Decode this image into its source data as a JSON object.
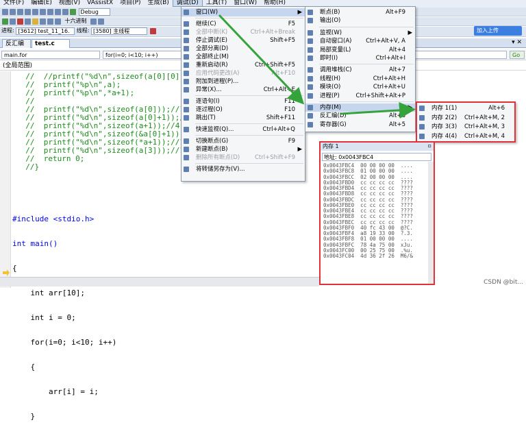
{
  "menubar": [
    "文件(F)",
    "编辑(E)",
    "视图(V)",
    "VAssistX",
    "项目(P)",
    "生成(B)",
    "调试(D)",
    "工具(T)",
    "窗口(W)",
    "帮助(H)"
  ],
  "toolbar": {
    "config": "Debug",
    "hex": "十六进制"
  },
  "process_bar": {
    "process_label": "进程:",
    "process_value": "[3612] test_11_16.",
    "thread_label": "线程:",
    "thread_value": "[3580] 主线程"
  },
  "reload_button": "加入上传",
  "tabs": [
    "反汇编",
    "test.c"
  ],
  "nav": {
    "left": "main.for",
    "right": "for(i=0; i<10; i++)",
    "go": "Go"
  },
  "scope": "(全局范围)",
  "code_lines": [
    {
      "t": "cm",
      "s": "  //  //printf(\"%d\\n\",sizeof(a[0][0]))"
    },
    {
      "t": "cm",
      "s": "  //  printf(\"%p\\n\",a);"
    },
    {
      "t": "cm",
      "s": "  //  printf(\"%p\\n\",*a+1);"
    },
    {
      "t": "cm",
      "s": "  //"
    },
    {
      "t": "cm",
      "s": "  //  printf(\"%d\\n\",sizeof(a[0]));//16"
    },
    {
      "t": "cm",
      "s": "  //  printf(\"%d\\n\",sizeof(a[0]+1));//4"
    },
    {
      "t": "cm",
      "s": "  //  printf(\"%d\\n\",sizeof(a+1));//4"
    },
    {
      "t": "cm",
      "s": "  //  printf(\"%d\\n\",sizeof(&a[0]+1));/"
    },
    {
      "t": "cm",
      "s": "  //  printf(\"%d\\n\",sizeof(*a+1));//16"
    },
    {
      "t": "cm",
      "s": "  //  printf(\"%d\\n\",sizeof(a[3]));//16"
    },
    {
      "t": "cm",
      "s": "  //  return 0;"
    },
    {
      "t": "cm",
      "s": "  //}"
    }
  ],
  "code2": {
    "include": "#include <stdio.h>",
    "main": "int main()",
    "brace": "{",
    "arr": "    int arr[10];",
    "i": "    int i = 0;",
    "for": "    for(i=0; i<10; i++)",
    "brace2": "    {",
    "assign": "        arr[i] = i;",
    "brace3": "    }"
  },
  "debug_menu": [
    {
      "label": "窗口(W)",
      "arrow": "▶",
      "hl": true
    },
    {
      "sep": true
    },
    {
      "label": "继续(C)",
      "shortcut": "F5"
    },
    {
      "label": "全部中断(K)",
      "shortcut": "Ctrl+Alt+Break",
      "dis": true
    },
    {
      "label": "停止调试(E)",
      "shortcut": "Shift+F5"
    },
    {
      "label": "全部分离(D)"
    },
    {
      "label": "全部终止(M)"
    },
    {
      "label": "重新启动(R)",
      "shortcut": "Ctrl+Shift+F5"
    },
    {
      "label": "应用代码更改(A)",
      "shortcut": "Alt+F10",
      "dis": true
    },
    {
      "label": "附加到进程(P)..."
    },
    {
      "label": "异常(X)...",
      "shortcut": "Ctrl+Alt+E"
    },
    {
      "sep": true
    },
    {
      "label": "逐语句(I)",
      "shortcut": "F11"
    },
    {
      "label": "逐过程(O)",
      "shortcut": "F10"
    },
    {
      "label": "跳出(T)",
      "shortcut": "Shift+F11"
    },
    {
      "sep": true
    },
    {
      "label": "快速监视(Q)...",
      "shortcut": "Ctrl+Alt+Q"
    },
    {
      "sep": true
    },
    {
      "label": "切换断点(G)",
      "shortcut": "F9"
    },
    {
      "label": "新建断点(B)",
      "arrow": "▶"
    },
    {
      "label": "删除所有断点(D)",
      "shortcut": "Ctrl+Shift+F9",
      "dis": true
    },
    {
      "sep": true
    },
    {
      "label": "将转储另存为(V)..."
    }
  ],
  "window_menu": [
    {
      "label": "断点(B)",
      "shortcut": "Alt+F9"
    },
    {
      "label": "输出(O)"
    },
    {
      "sep": true
    },
    {
      "label": "监视(W)",
      "arrow": "▶"
    },
    {
      "label": "自动窗口(A)",
      "shortcut": "Ctrl+Alt+V, A"
    },
    {
      "label": "局部变量(L)",
      "shortcut": "Alt+4"
    },
    {
      "label": "即时(I)",
      "shortcut": "Ctrl+Alt+I"
    },
    {
      "sep": true
    },
    {
      "label": "调用堆栈(C)",
      "shortcut": "Alt+7"
    },
    {
      "label": "线程(H)",
      "shortcut": "Ctrl+Alt+H"
    },
    {
      "label": "模块(O)",
      "shortcut": "Ctrl+Alt+U"
    },
    {
      "label": "进程(P)",
      "shortcut": "Ctrl+Shift+Alt+P"
    },
    {
      "sep": true
    },
    {
      "label": "内存(M)",
      "arrow": "▶",
      "hl": true
    },
    {
      "label": "反汇编(D)",
      "shortcut": "Alt+8"
    },
    {
      "label": "寄存器(G)",
      "shortcut": "Alt+5"
    }
  ],
  "memory_submenu": [
    {
      "label": "内存 1(1)",
      "shortcut": "Alt+6"
    },
    {
      "label": "内存 2(2)",
      "shortcut": "Ctrl+Alt+M, 2"
    },
    {
      "label": "内存 3(3)",
      "shortcut": "Ctrl+Alt+M, 3"
    },
    {
      "label": "内存 4(4)",
      "shortcut": "Ctrl+Alt+M, 4"
    }
  ],
  "memory_window": {
    "title": "内存 1",
    "address": "地址: 0x0043FBC4",
    "rows": [
      "0x0043FBC4  00 00 00 00  ....",
      "0x0043FBC8  01 00 00 00  ....",
      "0x0043FBCC  02 00 00 00  ....",
      "0x0043FBD0  cc cc cc cc  ????",
      "0x0043FBD4  cc cc cc cc  ????",
      "0x0043FBD8  cc cc cc cc  ????",
      "0x0043FBDC  cc cc cc cc  ????",
      "0x0043FBE0  cc cc cc cc  ????",
      "0x0043FBE4  cc cc cc cc  ????",
      "0x0043FBE8  cc cc cc cc  ????",
      "0x0043FBEC  cc cc cc cc  ????",
      "0x0043FBF0  40 fc 43 00  @?C.",
      "0x0043FBF4  a8 19 33 00  ?.3.",
      "0x0043FBF8  01 00 00 00  ....",
      "0x0043FBFC  78 4a 75 00  xJu.",
      "0x0043FC00  00 25 75 00  .%u.",
      "0x0043FC04  4d 36 2f 26  M6/&"
    ]
  },
  "watermark": "CSDN @bit..."
}
